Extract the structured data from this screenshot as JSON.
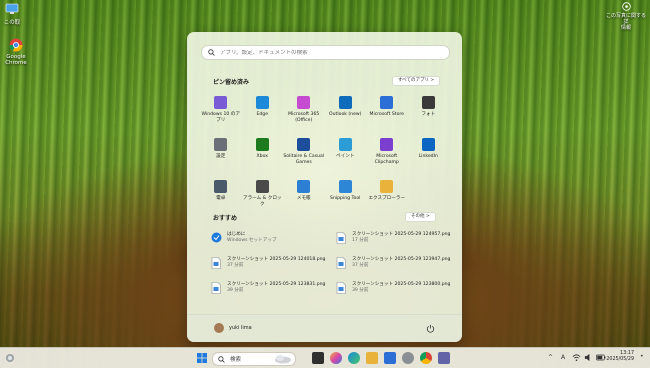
{
  "desktop": {
    "icons": [
      {
        "label": "この取"
      },
      {
        "label": "Google Chrome"
      }
    ],
    "corner_note": "この写真に関する詳\n情報"
  },
  "start": {
    "search_placeholder": "アプリ、設定、ドキュメントの検索",
    "pinned_title": "ピン留め済み",
    "pinned_button": "すべてのアプリ >",
    "pinned": [
      {
        "label": "Windows 10 のアプリ",
        "icon": "windows-apps-icon",
        "color": "#7a5bd6"
      },
      {
        "label": "Edge",
        "icon": "edge-icon",
        "color": "#1c8ad9"
      },
      {
        "label": "Microsoft 365 (Office)",
        "icon": "m365-icon",
        "color": "#c54bd1"
      },
      {
        "label": "Outlook (new)",
        "icon": "outlook-icon",
        "color": "#0f6cbd"
      },
      {
        "label": "Microsoft Store",
        "icon": "store-icon",
        "color": "#2b6fd6"
      },
      {
        "label": "フォト",
        "icon": "photos-icon",
        "color": "#3a3a3a"
      },
      {
        "label": "設定",
        "icon": "settings-gear-icon",
        "color": "#6b7078"
      },
      {
        "label": "Xbox",
        "icon": "xbox-icon",
        "color": "#1e7a1e"
      },
      {
        "label": "Solitaire & Casual Games",
        "icon": "solitaire-icon",
        "color": "#1d4e9c"
      },
      {
        "label": "ペイント",
        "icon": "paint-icon",
        "color": "#2b9cd6"
      },
      {
        "label": "Microsoft Clipchamp",
        "icon": "clipchamp-icon",
        "color": "#7b3fd0"
      },
      {
        "label": "LinkedIn",
        "icon": "linkedin-icon",
        "color": "#0a66c2"
      },
      {
        "label": "電卓",
        "icon": "calculator-icon",
        "color": "#4a5a6b"
      },
      {
        "label": "アラーム & クロック",
        "icon": "alarm-clock-icon",
        "color": "#4a4a4a"
      },
      {
        "label": "メモ帳",
        "icon": "notepad-icon",
        "color": "#2d7fd3"
      },
      {
        "label": "Snipping Tool",
        "icon": "snipping-tool-icon",
        "color": "#2d86d6"
      },
      {
        "label": "エクスプローラー",
        "icon": "file-explorer-icon",
        "color": "#e9b33b"
      }
    ],
    "recommended_title": "おすすめ",
    "recommended_button": "その他 >",
    "recommended": [
      {
        "title": "はじめに",
        "sub": "Windows セットアップ",
        "icon": "get-started-icon"
      },
      {
        "title": "スクリーンショット 2025-05-29 124957.png",
        "sub": "17 分前",
        "icon": "image-file-icon"
      },
      {
        "title": "スクリーンショット 2025-05-29 124018.png",
        "sub": "37 分前",
        "icon": "image-file-icon"
      },
      {
        "title": "スクリーンショット 2025-05-29 123947.png",
        "sub": "37 分前",
        "icon": "image-file-icon"
      },
      {
        "title": "スクリーンショット 2025-05-29 123831.png",
        "sub": "39 分前",
        "icon": "image-file-icon"
      },
      {
        "title": "スクリーンショット 2025-05-29 123800.png",
        "sub": "39 分前",
        "icon": "image-file-icon"
      }
    ],
    "user_name": "yuki lima"
  },
  "taskbar": {
    "search_label": "検索",
    "time": "13:17",
    "date": "2025/05/29",
    "ime": "A"
  }
}
